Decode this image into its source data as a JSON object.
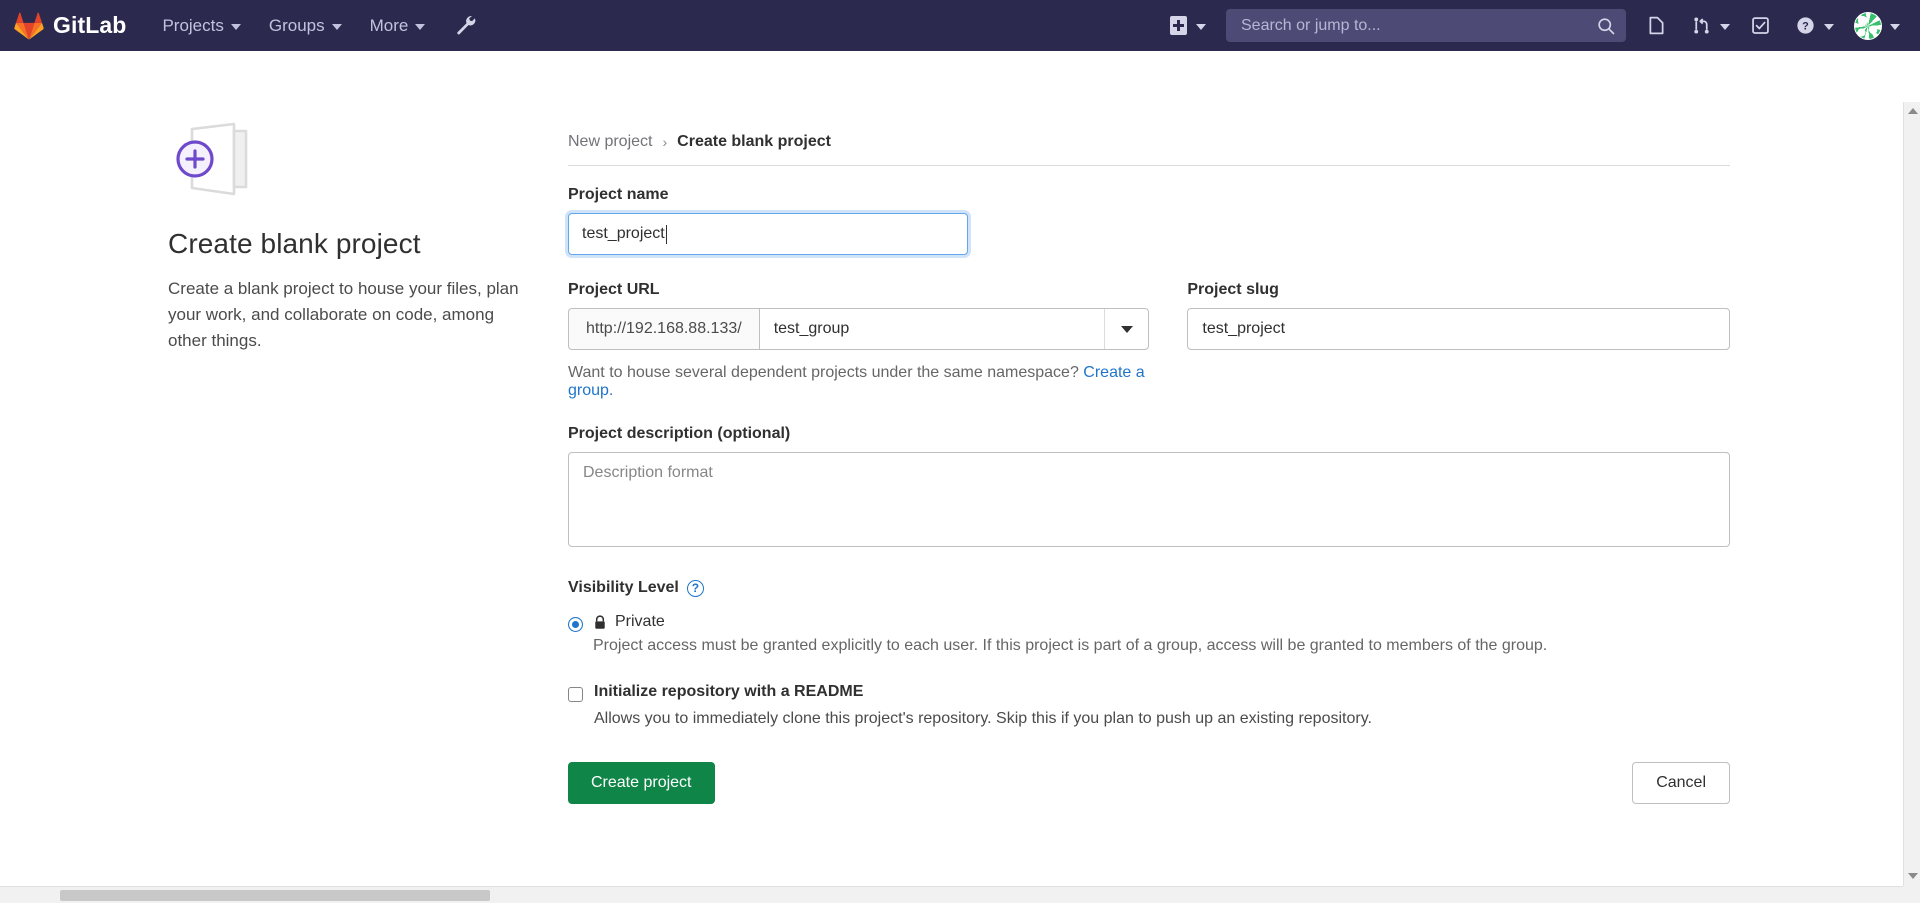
{
  "navbar": {
    "brand": "GitLab",
    "menus": [
      {
        "label": "Projects",
        "icon": "chevron-down-icon"
      },
      {
        "label": "Groups",
        "icon": "chevron-down-icon"
      },
      {
        "label": "More",
        "icon": "chevron-down-icon"
      }
    ],
    "admin_icon": "wrench-icon",
    "new_dropdown": {
      "icon": "plus-square-icon",
      "chevron": "chevron-down-icon"
    },
    "search": {
      "placeholder": "Search or jump to...",
      "value": "",
      "icon": "search-icon"
    },
    "right_icons": [
      {
        "name": "issues-icon",
        "label": "Issues"
      },
      {
        "name": "merge-requests-icon",
        "label": "Merge requests"
      },
      {
        "name": "todos-icon",
        "label": "To-Do List"
      },
      {
        "name": "help-icon",
        "label": "Help"
      }
    ],
    "avatar": {
      "name": "avatar",
      "label": "User menu"
    },
    "background_color": "#2b2a4e"
  },
  "aside": {
    "icon": "blank-project-icon",
    "title": "Create blank project",
    "description": "Create a blank project to house your files, plan your work, and collaborate on code, among other things."
  },
  "breadcrumb": {
    "parent": "New project",
    "separator": "›",
    "current": "Create blank project"
  },
  "form": {
    "project_name": {
      "label": "Project name",
      "value": "test_project",
      "placeholder": ""
    },
    "project_url": {
      "label": "Project URL",
      "prefix": "http://192.168.88.133/",
      "namespace_selected": "test_group",
      "namespace_options": [
        "test_group"
      ],
      "chevron": "chevron-down-icon"
    },
    "project_slug": {
      "label": "Project slug",
      "value": "test_project"
    },
    "namespace_hint": {
      "text": "Want to house several dependent projects under the same namespace?",
      "link": "Create a group.",
      "link_color": "#1f75cb"
    },
    "project_description": {
      "label": "Project description (optional)",
      "placeholder": "Description format",
      "value": ""
    },
    "visibility": {
      "label": "Visibility Level",
      "help_icon": "question-circle-icon",
      "help_glyph": "?",
      "options": [
        {
          "id": "private",
          "icon": "lock-icon",
          "title": "Private",
          "description": "Project access must be granted explicitly to each user. If this project is part of a group, access will be granted to members of the group.",
          "selected": true
        }
      ]
    },
    "readme": {
      "title": "Initialize repository with a README",
      "description": "Allows you to immediately clone this project's repository. Skip this if you plan to push up an existing repository.",
      "checked": false
    },
    "actions": {
      "create_label": "Create project",
      "create_color": "#108548",
      "cancel_label": "Cancel"
    }
  },
  "scrollbars": {
    "vertical": {
      "up_icon": "scroll-up-arrow-icon",
      "down_icon": "scroll-down-arrow-icon"
    },
    "horizontal": {
      "thumb": "horizontal-scroll-thumb"
    }
  }
}
